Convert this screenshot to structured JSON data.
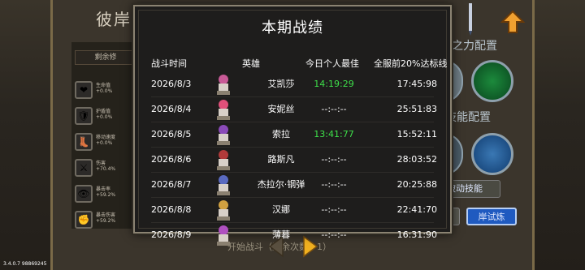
{
  "background": {
    "title": "彼岸试炼",
    "remaining_label": "剩余修",
    "stats": [
      {
        "icon": "heart-icon",
        "glyph": "❤",
        "name": "生命值",
        "value": "+0.0%"
      },
      {
        "icon": "shield-icon",
        "glyph": "🛡",
        "name": "护盾值",
        "value": "+0.0%"
      },
      {
        "icon": "boot-icon",
        "glyph": "👢",
        "name": "移动速度",
        "value": "+0.0%"
      },
      {
        "icon": "sword-icon",
        "glyph": "⚔",
        "name": "伤害",
        "value": "+70.4%"
      },
      {
        "icon": "eye-icon",
        "glyph": "👁",
        "name": "暴击率",
        "value": "+59.2%"
      },
      {
        "icon": "fist-icon",
        "glyph": "✊",
        "name": "暴击伤害",
        "value": "+59.2%"
      }
    ],
    "right_label_1": "之力配置",
    "right_label_2": "技能配置",
    "passive_button": "被动技能",
    "trial_button": "岸试炼",
    "start_text": "开始战斗（剩余次数：1）",
    "version": "3.4.0.7 98869245"
  },
  "dialog": {
    "title": "本期战绩",
    "columns": {
      "time": "战斗时间",
      "hero": "英雄",
      "best": "今日个人最佳",
      "server": "全服前20%达标线"
    },
    "rows": [
      {
        "date": "2026/8/3",
        "hero": "艾凯莎",
        "best": "14:19:29",
        "best_green": true,
        "server": "17:45:98",
        "avatar_color": "#c85a96"
      },
      {
        "date": "2026/8/4",
        "hero": "安妮丝",
        "best": "--:--:--",
        "best_green": false,
        "server": "25:51:83",
        "avatar_color": "#e0507a"
      },
      {
        "date": "2026/8/5",
        "hero": "索拉",
        "best": "13:41:77",
        "best_green": true,
        "server": "15:52:11",
        "avatar_color": "#8a4ab8"
      },
      {
        "date": "2026/8/6",
        "hero": "路斯凡",
        "best": "--:--:--",
        "best_green": false,
        "server": "28:03:52",
        "avatar_color": "#b03a3a"
      },
      {
        "date": "2026/8/7",
        "hero": "杰拉尔·钢弹",
        "best": "--:--:--",
        "best_green": false,
        "server": "20:25:88",
        "avatar_color": "#5a6ac0"
      },
      {
        "date": "2026/8/8",
        "hero": "汉娜",
        "best": "--:--:--",
        "best_green": false,
        "server": "22:41:70",
        "avatar_color": "#d0a040"
      },
      {
        "date": "2026/8/9",
        "hero": "薄暮",
        "best": "--:--:--",
        "best_green": false,
        "server": "16:31:90",
        "avatar_color": "#b050c0"
      }
    ]
  },
  "colors": {
    "green": "#3ee04a",
    "modal_bg": "#1e1d1c",
    "modal_border": "#8b8372",
    "trial_blue": "#1f5ac0",
    "arrow_orange": "#f0a030"
  }
}
